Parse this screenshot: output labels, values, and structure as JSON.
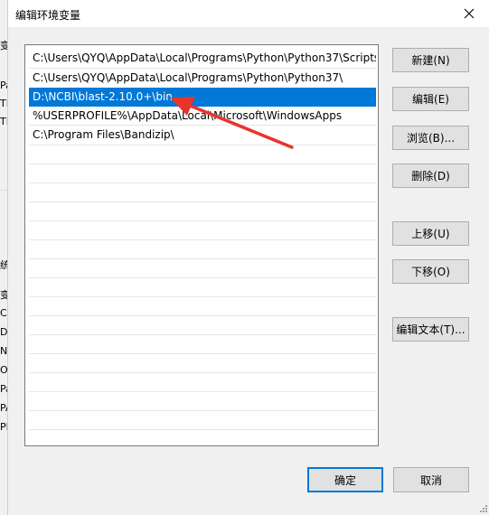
{
  "background": {
    "fragments": [
      "变",
      "Pa",
      "TE",
      "TM",
      "统",
      "变",
      "Co",
      "Dr",
      "NI",
      "O",
      "Pa",
      "PA",
      "PF"
    ]
  },
  "dialog": {
    "title": "编辑环境变量",
    "close_icon": "close-icon"
  },
  "list": {
    "items": [
      "C:\\Users\\QYQ\\AppData\\Local\\Programs\\Python\\Python37\\Scripts\\",
      "C:\\Users\\QYQ\\AppData\\Local\\Programs\\Python\\Python37\\",
      "D:\\NCBI\\blast-2.10.0+\\bin",
      "%USERPROFILE%\\AppData\\Local\\Microsoft\\WindowsApps",
      "C:\\Program Files\\Bandizip\\"
    ],
    "selected_index": 2
  },
  "buttons": {
    "new": "新建(N)",
    "edit": "编辑(E)",
    "browse": "浏览(B)...",
    "delete": "删除(D)",
    "move_up": "上移(U)",
    "move_down": "下移(O)",
    "edit_text": "编辑文本(T)...",
    "ok": "确定",
    "cancel": "取消"
  },
  "colors": {
    "selection": "#0078d7",
    "arrow": "#e8352c"
  }
}
